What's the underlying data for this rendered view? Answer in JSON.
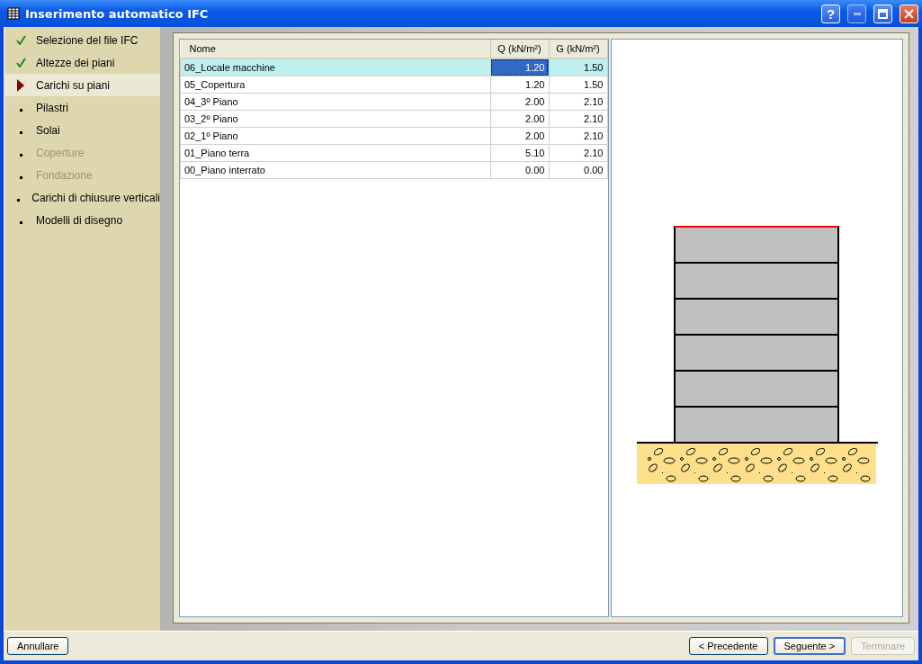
{
  "window": {
    "title": "Inserimento automatico IFC",
    "help": "?"
  },
  "steps": [
    {
      "label": "Selezione del file IFC",
      "kind": "done",
      "selected": false,
      "disabled": false
    },
    {
      "label": "Altezze dei piani",
      "kind": "done",
      "selected": false,
      "disabled": false
    },
    {
      "label": "Carichi su piani",
      "kind": "current",
      "selected": true,
      "disabled": false
    },
    {
      "label": "Pilastri",
      "kind": "todo",
      "selected": false,
      "disabled": false
    },
    {
      "label": "Solai",
      "kind": "todo",
      "selected": false,
      "disabled": false
    },
    {
      "label": "Coperture",
      "kind": "todo",
      "selected": false,
      "disabled": true
    },
    {
      "label": "Fondazione",
      "kind": "todo",
      "selected": false,
      "disabled": true
    },
    {
      "label": "Carichi di chiusure verticali",
      "kind": "todo",
      "selected": false,
      "disabled": false
    },
    {
      "label": "Modelli di disegno",
      "kind": "todo",
      "selected": false,
      "disabled": false
    }
  ],
  "table": {
    "columns": [
      "Nome",
      "Q (kN/m²)",
      "G (kN/m²)"
    ],
    "rows": [
      {
        "name": "06_Locale macchine",
        "q": "1.20",
        "g": "1.50",
        "selected": true
      },
      {
        "name": "05_Copertura",
        "q": "1.20",
        "g": "1.50",
        "selected": false
      },
      {
        "name": "04_3º Piano",
        "q": "2.00",
        "g": "2.10",
        "selected": false
      },
      {
        "name": "03_2º Piano",
        "q": "2.00",
        "g": "2.10",
        "selected": false
      },
      {
        "name": "02_1º Piano",
        "q": "2.00",
        "g": "2.10",
        "selected": false
      },
      {
        "name": "01_Piano terra",
        "q": "5.10",
        "g": "2.10",
        "selected": false
      },
      {
        "name": "00_Piano interrato",
        "q": "0.00",
        "g": "0.00",
        "selected": false
      }
    ]
  },
  "buttons": [
    {
      "label": "Annullare",
      "kind": "left",
      "default": false,
      "disabled": false
    },
    {
      "label": "< Precedente",
      "kind": "right",
      "default": false,
      "disabled": false
    },
    {
      "label": "Seguente >",
      "kind": "right",
      "default": true,
      "disabled": false
    },
    {
      "label": "Terminare",
      "kind": "right",
      "default": false,
      "disabled": true
    }
  ]
}
